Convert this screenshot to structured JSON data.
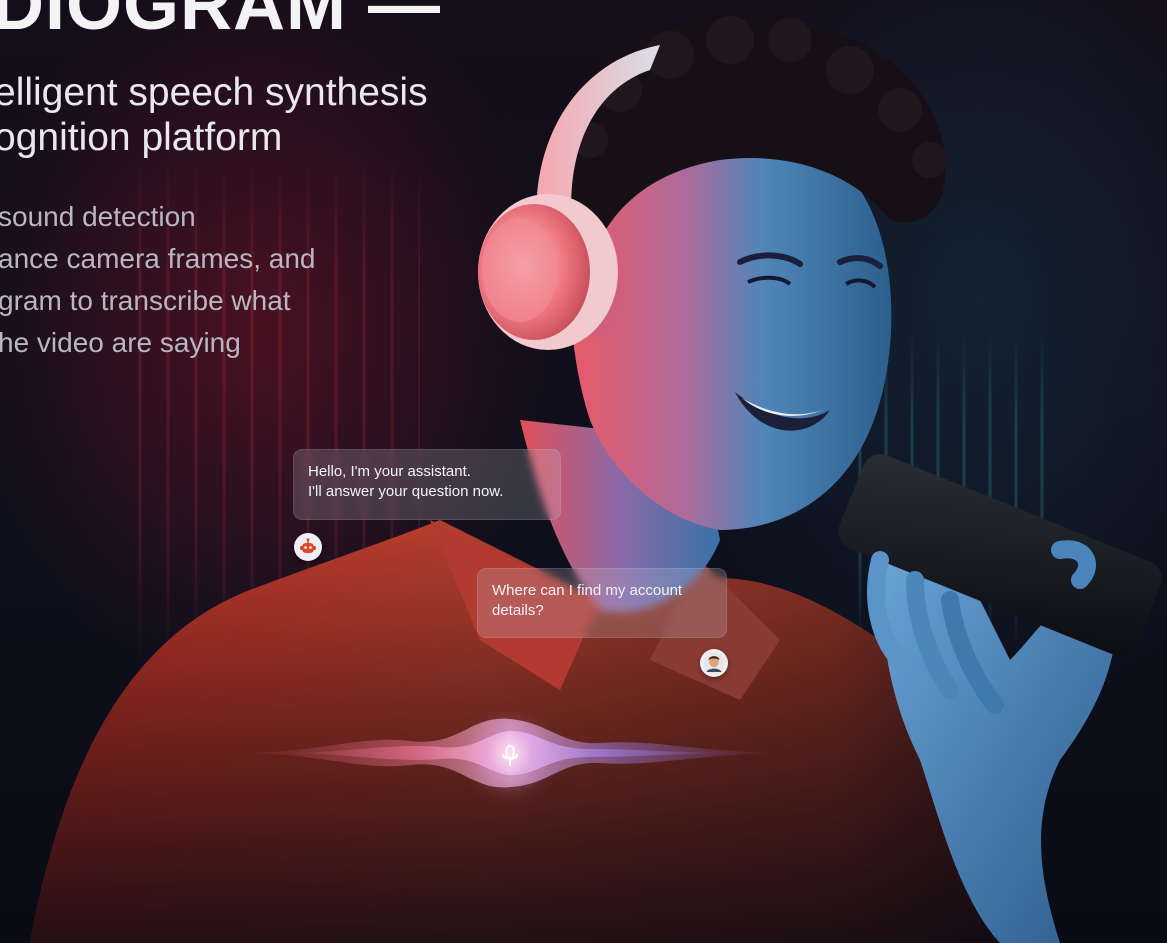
{
  "hero": {
    "headline": "DIOGRAM —",
    "subheadline_lines": [
      "elligent speech synthesis",
      "ognition platform"
    ],
    "description_lines": [
      "sound detection",
      "ance camera frames, and",
      "gram to transcribe what",
      "he video are saying"
    ]
  },
  "chat": {
    "assistant_lines": [
      "Hello, I'm your assistant.",
      "I'll answer your question now."
    ],
    "user_lines": [
      "Where can I find my account",
      "details?"
    ]
  },
  "icons": {
    "assistant_avatar": "robot-icon",
    "user_avatar": "user-avatar-icon",
    "mic": "microphone-icon"
  },
  "colors": {
    "background": "#0b0d17",
    "headline": "#f3f2f5",
    "description": "#b9b6c3",
    "bubble_bg": "rgba(200,200,215,0.22)",
    "red_light": "#ff3b4a",
    "cyan_light": "#3fd0e6",
    "wave_pink": "#ff7ab8",
    "wave_violet": "#a68cff"
  }
}
